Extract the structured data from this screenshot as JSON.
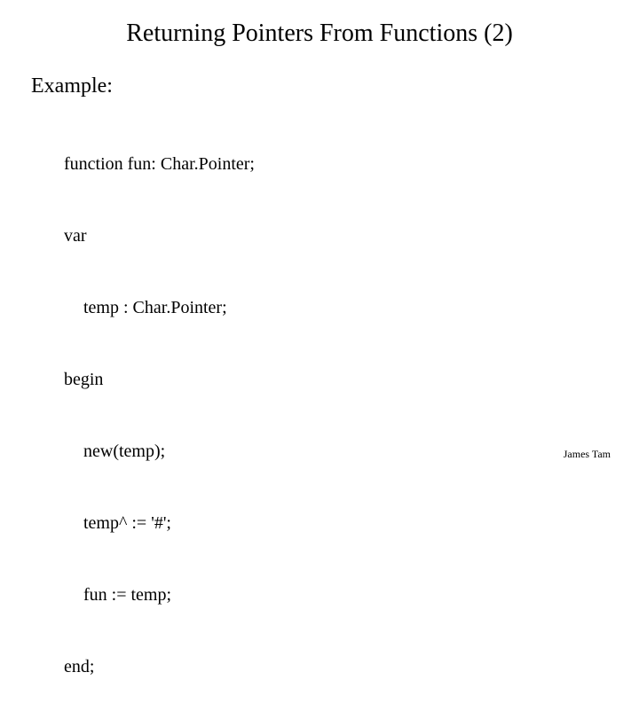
{
  "title": "Returning Pointers From Functions (2)",
  "section_label": "Example:",
  "code": {
    "l1": "function fun: Char.Pointer;",
    "l2": "var",
    "l3": "temp : Char.Pointer;",
    "l4": "begin",
    "l5": "new(temp);",
    "l6": "temp^ := '#';",
    "l7": "fun := temp;",
    "l8": "end;"
  },
  "author": "James Tam"
}
